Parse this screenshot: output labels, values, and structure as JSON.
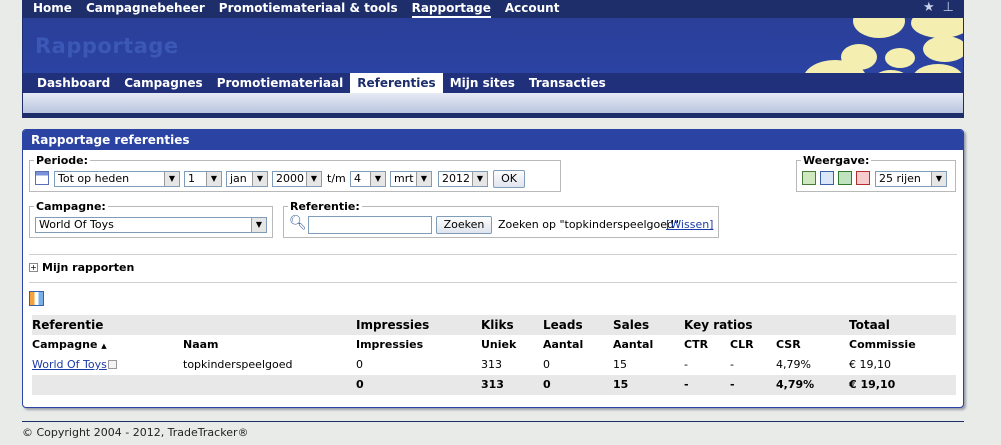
{
  "topnav": {
    "items": [
      "Home",
      "Campagnebeheer",
      "Promotiemateriaal & tools",
      "Rapportage",
      "Account"
    ],
    "active_index": 3,
    "icons": [
      "star-icon",
      "sitemap-icon"
    ]
  },
  "banner": {
    "title": "Rapportage",
    "tabs": [
      "Dashboard",
      "Campagnes",
      "Promotiemateriaal",
      "Referenties",
      "Mijn sites",
      "Transacties"
    ],
    "active_tab_index": 3
  },
  "panel": {
    "title": "Rapportage referenties",
    "periode": {
      "legend": "Periode:",
      "range": "Tot op heden",
      "from_day": "1",
      "from_month": "jan",
      "from_year": "2000",
      "separator": "t/m",
      "to_day": "4",
      "to_month": "mrt",
      "to_year": "2012",
      "ok_label": "OK"
    },
    "weergave": {
      "legend": "Weergave:",
      "rows": "25 rijen",
      "icons": [
        "export-icon",
        "print-icon",
        "excel-icon",
        "pdf-icon"
      ]
    },
    "campagne": {
      "legend": "Campagne:",
      "value": "World Of Toys"
    },
    "referentie": {
      "legend": "Referentie:",
      "value": "",
      "search_label": "Zoeken",
      "search_text": "Zoeken op \"topkinderspeelgoed\"",
      "clear_label": "[Wissen]"
    },
    "mijn_rapporten": "Mijn rapporten",
    "table": {
      "groups": [
        "Referentie",
        "Impressies",
        "Kliks",
        "Leads",
        "Sales",
        "Key ratios",
        "Totaal"
      ],
      "headers": [
        "Campagne",
        "Naam",
        "Impressies",
        "Uniek",
        "Aantal",
        "Aantal",
        "CTR",
        "CLR",
        "CSR",
        "Commissie"
      ],
      "sort_indicator": "▲",
      "rows": [
        {
          "campagne": "World Of Toys",
          "naam": "topkinderspeelgoed",
          "impressies": "0",
          "uniek": "313",
          "leads": "0",
          "sales": "15",
          "ctr": "-",
          "clr": "-",
          "csr": "4,79%",
          "commissie": "€ 19,10"
        }
      ],
      "total": {
        "impressies": "0",
        "uniek": "313",
        "leads": "0",
        "sales": "15",
        "ctr": "-",
        "clr": "-",
        "csr": "4,79%",
        "commissie": "€ 19,10"
      }
    }
  },
  "footer": "© Copyright 2004 - 2012, TradeTracker®"
}
